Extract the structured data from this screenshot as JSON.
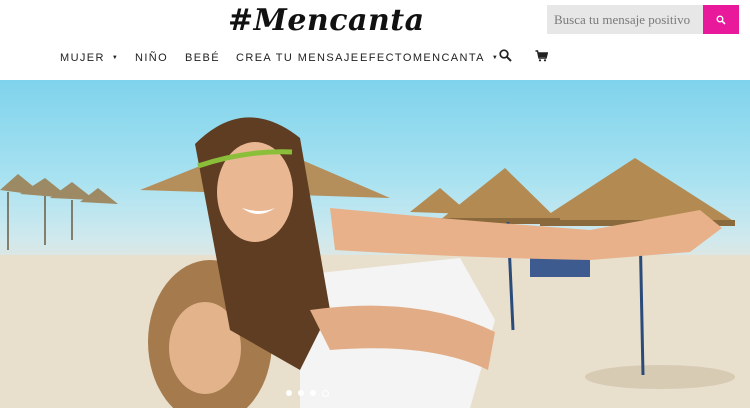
{
  "brand": {
    "logo_text": "#Mencanta"
  },
  "search": {
    "placeholder": "Busca tu mensaje positivo",
    "icon": "search-icon"
  },
  "nav": {
    "items": [
      {
        "label": "MUJER",
        "has_dropdown": true
      },
      {
        "label": "NIÑO",
        "has_dropdown": false
      },
      {
        "label": "BEBÉ",
        "has_dropdown": false
      },
      {
        "label": "CREA TU MENSAJE",
        "has_dropdown": false
      },
      {
        "label": "EFECTOMENCANTA",
        "has_dropdown": true
      }
    ],
    "search_icon": "search-icon",
    "cart_icon": "cart-icon"
  },
  "hero": {
    "slide_count": 4,
    "active_slide": 4
  },
  "colors": {
    "accent": "#e8199a",
    "search_bg": "#e7e7e7",
    "text": "#222222"
  }
}
